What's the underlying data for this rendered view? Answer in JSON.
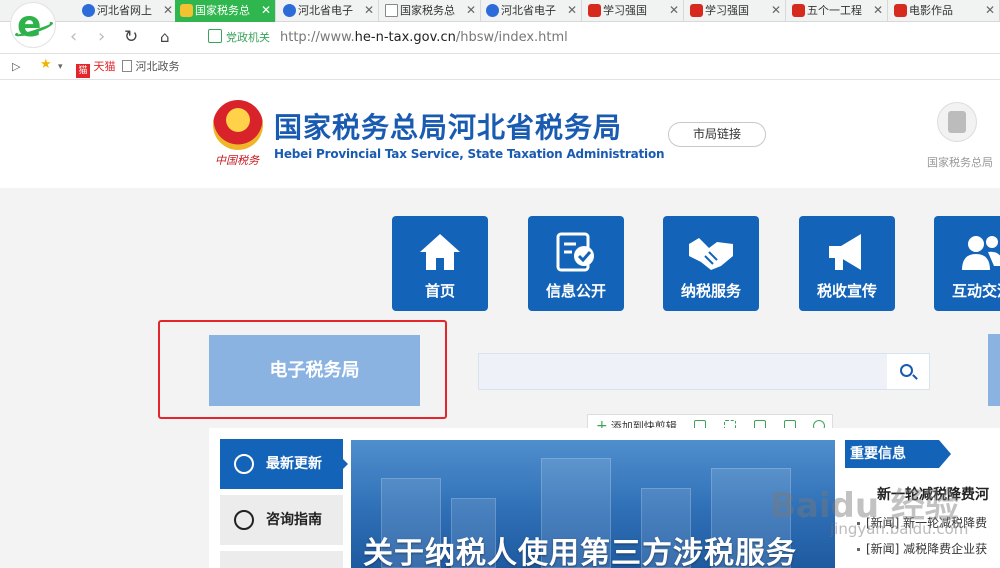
{
  "browser": {
    "tabs": [
      {
        "label": "河北省网上",
        "icon": "baidu-paw-icon",
        "active": false
      },
      {
        "label": "国家税务总",
        "icon": "tax-emblem-icon",
        "active": true
      },
      {
        "label": "河北省电子",
        "icon": "baidu-paw-icon",
        "active": false
      },
      {
        "label": "国家税务总",
        "icon": "document-icon",
        "active": false
      },
      {
        "label": "河北省电子",
        "icon": "baidu-paw-icon",
        "active": false
      },
      {
        "label": "学习强国",
        "icon": "xuexi-icon",
        "active": false
      },
      {
        "label": "学习强国",
        "icon": "xuexi-icon",
        "active": false
      },
      {
        "label": "五个一工程",
        "icon": "xuexi-icon",
        "active": false
      },
      {
        "label": "电影作品",
        "icon": "xuexi-icon",
        "active": false
      }
    ],
    "address": {
      "badge": "党政机关",
      "url_prefix": "http://www.",
      "url_domain": "he-n-tax.gov.cn",
      "url_path": "/hbsw/index.html"
    },
    "bookmarks": [
      {
        "label": "天猫",
        "icon": "tmall-icon"
      },
      {
        "label": "河北政务",
        "icon": "document-icon"
      }
    ],
    "accent": "#30b64e"
  },
  "site": {
    "emblem_caption": "中国税务",
    "title": "国家税务总局河北省税务局",
    "subtitle": "Hebei Provincial Tax Service, State Taxation Administration",
    "city_link": "市局链接",
    "national_caption": "国家税务总局",
    "brand_color": "#1363b8"
  },
  "nav": [
    {
      "label": "首页",
      "icon": "home-icon"
    },
    {
      "label": "信息公开",
      "icon": "document-check-icon"
    },
    {
      "label": "纳税服务",
      "icon": "handshake-icon"
    },
    {
      "label": "税收宣传",
      "icon": "megaphone-icon"
    },
    {
      "label": "互动交流",
      "icon": "people-icon"
    }
  ],
  "etax": {
    "label": "电子税务局"
  },
  "search": {
    "placeholder": "",
    "value": ""
  },
  "toolbar": {
    "add_label": "添加到快剪辑"
  },
  "side_menu": [
    {
      "label": "最新更新",
      "icon": "clock-refresh-icon",
      "active": true
    },
    {
      "label": "咨询指南",
      "icon": "chat-icon",
      "active": false
    }
  ],
  "banner": {
    "text": "关于纳税人使用第三方涉税服务"
  },
  "news": {
    "header": "重要信息",
    "headline": "新一轮减税降费河",
    "items": [
      "[新闻] 新一轮减税降费",
      "[新闻] 减税降费企业获"
    ]
  },
  "watermark": {
    "text": "Baidu 经验",
    "sub": "jingyan.baidu.com"
  }
}
